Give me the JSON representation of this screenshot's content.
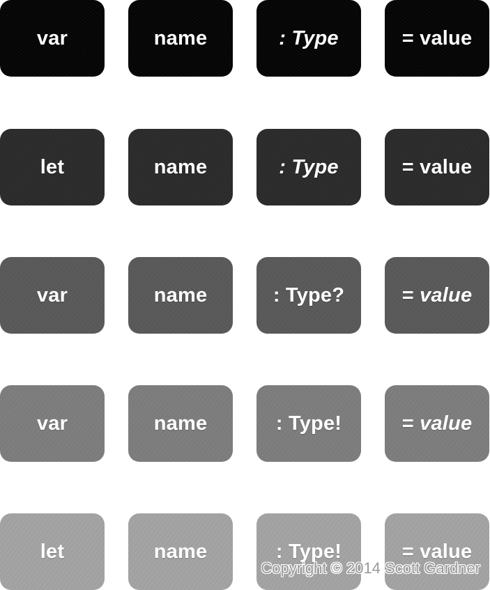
{
  "rows": [
    {
      "color": "#050505",
      "tiles": [
        {
          "parts": [
            {
              "text": "var",
              "italic": false
            }
          ]
        },
        {
          "parts": [
            {
              "text": "name",
              "italic": false
            }
          ]
        },
        {
          "parts": [
            {
              "text": ": Type",
              "italic": true
            }
          ]
        },
        {
          "parts": [
            {
              "text": "= value",
              "italic": false
            }
          ]
        }
      ]
    },
    {
      "color": "#2b2b2b",
      "tiles": [
        {
          "parts": [
            {
              "text": "let",
              "italic": false
            }
          ]
        },
        {
          "parts": [
            {
              "text": "name",
              "italic": false
            }
          ]
        },
        {
          "parts": [
            {
              "text": ": Type",
              "italic": true
            }
          ]
        },
        {
          "parts": [
            {
              "text": "= value",
              "italic": false
            }
          ]
        }
      ]
    },
    {
      "color": "#595959",
      "tiles": [
        {
          "parts": [
            {
              "text": "var",
              "italic": false
            }
          ]
        },
        {
          "parts": [
            {
              "text": "name",
              "italic": false
            }
          ]
        },
        {
          "parts": [
            {
              "text": ": Type?",
              "italic": false
            }
          ]
        },
        {
          "parts": [
            {
              "text": "= ",
              "italic": false
            },
            {
              "text": "value",
              "italic": true
            }
          ]
        }
      ]
    },
    {
      "color": "#7d7d7d",
      "tiles": [
        {
          "parts": [
            {
              "text": "var",
              "italic": false
            }
          ]
        },
        {
          "parts": [
            {
              "text": "name",
              "italic": false
            }
          ]
        },
        {
          "parts": [
            {
              "text": ": Type!",
              "italic": false
            }
          ]
        },
        {
          "parts": [
            {
              "text": "= ",
              "italic": false
            },
            {
              "text": "value",
              "italic": true
            }
          ]
        }
      ]
    },
    {
      "color": "#a3a3a3",
      "tiles": [
        {
          "parts": [
            {
              "text": "let",
              "italic": false
            }
          ]
        },
        {
          "parts": [
            {
              "text": "name",
              "italic": false
            }
          ]
        },
        {
          "parts": [
            {
              "text": ": Type!",
              "italic": false
            }
          ]
        },
        {
          "parts": [
            {
              "text": "= value",
              "italic": false
            }
          ]
        }
      ]
    }
  ],
  "copyright": "Copyright © 2014 Scott Gardner"
}
